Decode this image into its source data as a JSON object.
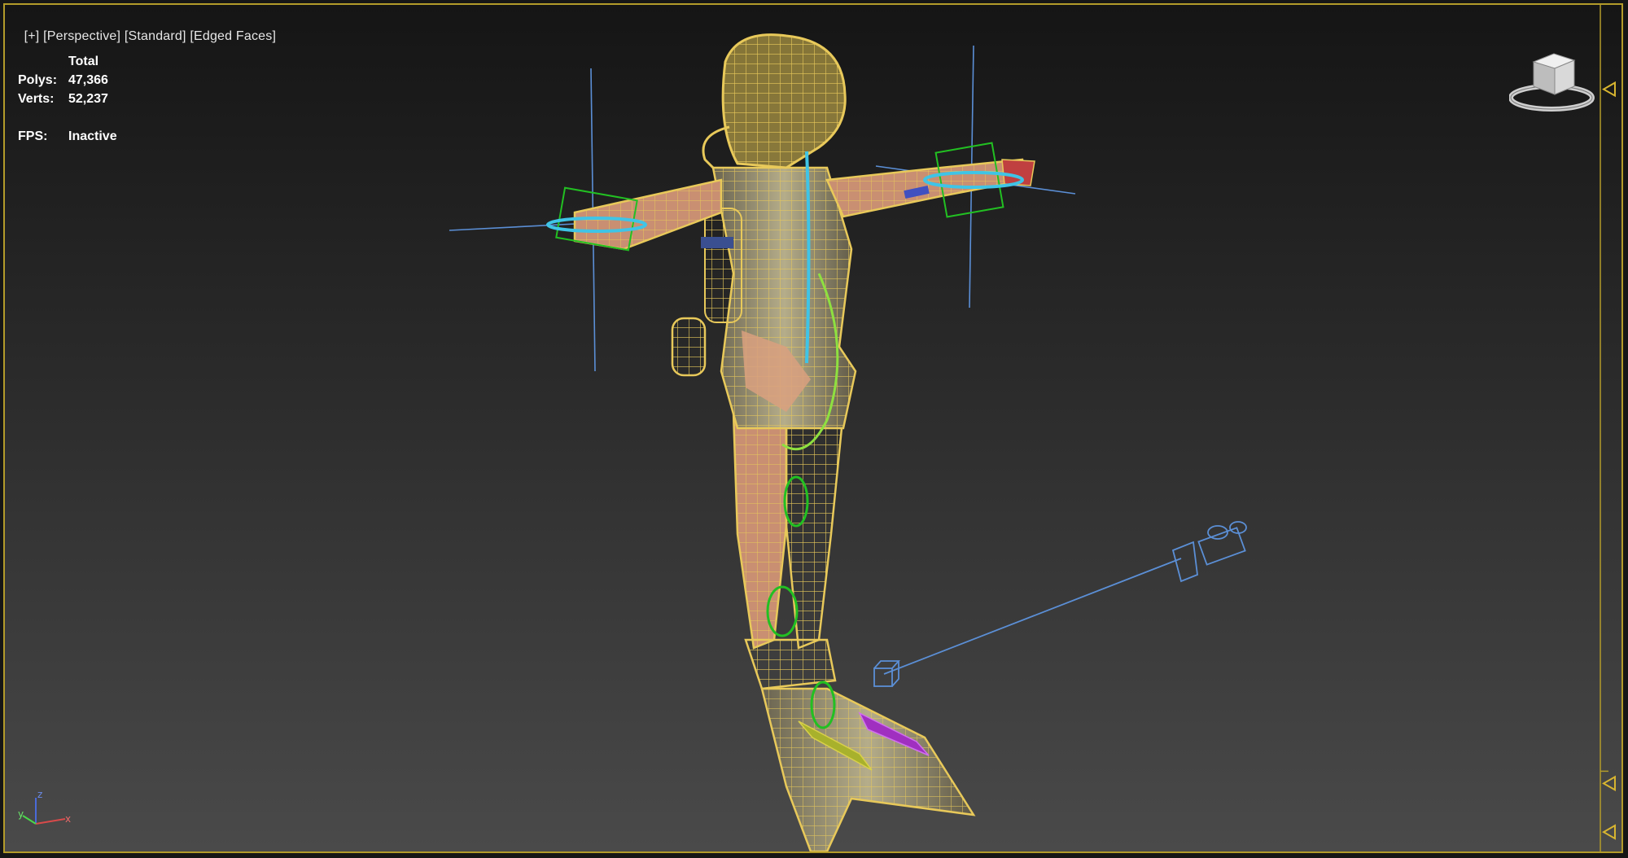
{
  "viewport": {
    "plus_label": "[+]",
    "view_label": "[Perspective]",
    "shading_label": "[Standard]",
    "faces_label": "[Edged Faces]"
  },
  "stats": {
    "header": "Total",
    "polys_label": "Polys:",
    "polys_value": "47,366",
    "verts_label": "Verts:",
    "verts_value": "52,237",
    "fps_label": "FPS:",
    "fps_value": "Inactive"
  },
  "axis_tripod": {
    "z": "z",
    "y": "y",
    "x": "x"
  },
  "colors": {
    "wireframe": "#e8c95a",
    "selection_border": "#b39b2a",
    "helper_blue": "#5b8fd6",
    "ik_green": "#22c022",
    "ik_cyan": "#3fc4e6",
    "skin": "#d9a07f",
    "fin_olive": "#a8b12c",
    "fin_purple": "#a030c0",
    "background_top": "#151515",
    "background_bottom": "#4a4a4a"
  },
  "icons": [
    "viewcube-icon",
    "axis-tripod-icon",
    "camera-icon",
    "ruler-triangle-icon"
  ]
}
